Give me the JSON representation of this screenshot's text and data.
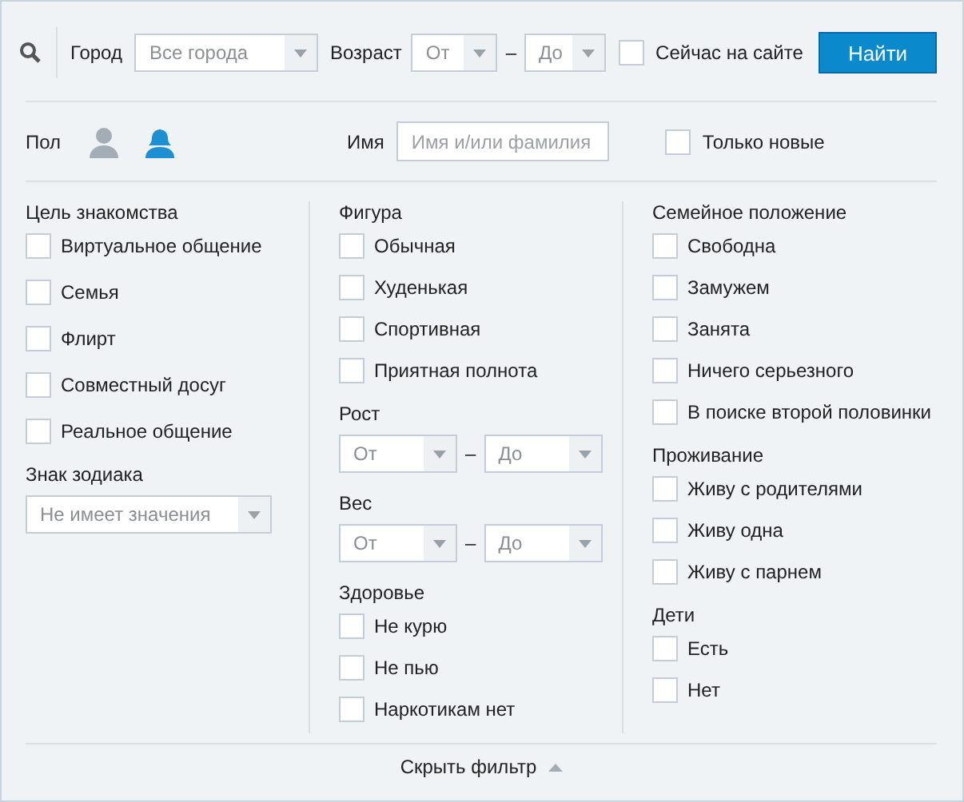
{
  "search": {
    "city": {
      "label": "Город",
      "value": "Все города"
    },
    "age": {
      "label": "Возраст",
      "from": "От",
      "dash": "–",
      "to": "До"
    },
    "online": {
      "label": "Сейчас на сайте",
      "checked": false
    },
    "button": "Найти"
  },
  "gender": {
    "label": "Пол",
    "options": [
      {
        "kind": "male",
        "selected": false
      },
      {
        "kind": "female",
        "selected": true
      }
    ]
  },
  "name": {
    "label": "Имя",
    "placeholder": "Имя и/или фамилия"
  },
  "only_new": {
    "label": "Только новые",
    "checked": false
  },
  "columns": [
    [
      {
        "title": "Цель знакомства",
        "kind": "checkboxes",
        "options": [
          {
            "label": "Виртуальное общение",
            "checked": false
          },
          {
            "label": "Семья",
            "checked": false
          },
          {
            "label": "Флирт",
            "checked": false
          },
          {
            "label": "Совместный досуг",
            "checked": false
          },
          {
            "label": "Реальное общение",
            "checked": false
          }
        ]
      },
      {
        "title": "Знак зодиака",
        "kind": "select",
        "value": "Не имеет значения"
      }
    ],
    [
      {
        "title": "Фигура",
        "kind": "checkboxes",
        "options": [
          {
            "label": "Обычная",
            "checked": false
          },
          {
            "label": "Худенькая",
            "checked": false
          },
          {
            "label": "Спортивная",
            "checked": false
          },
          {
            "label": "Приятная полнота",
            "checked": false
          }
        ]
      },
      {
        "title": "Рост",
        "kind": "range",
        "from": "От",
        "dash": "–",
        "to": "До"
      },
      {
        "title": "Вес",
        "kind": "range",
        "from": "От",
        "dash": "–",
        "to": "До"
      },
      {
        "title": "Здоровье",
        "kind": "checkboxes",
        "options": [
          {
            "label": "Не курю",
            "checked": false
          },
          {
            "label": "Не пью",
            "checked": false
          },
          {
            "label": "Наркотикам нет",
            "checked": false
          }
        ]
      }
    ],
    [
      {
        "title": "Семейное положение",
        "kind": "checkboxes",
        "options": [
          {
            "label": "Свободна",
            "checked": false
          },
          {
            "label": "Замужем",
            "checked": false
          },
          {
            "label": "Занята",
            "checked": false
          },
          {
            "label": "Ничего серьезного",
            "checked": false
          },
          {
            "label": "В поиске второй половинки",
            "checked": false
          }
        ]
      },
      {
        "title": "Проживание",
        "kind": "checkboxes",
        "options": [
          {
            "label": "Живу с родителями",
            "checked": false
          },
          {
            "label": "Живу одна",
            "checked": false
          },
          {
            "label": "Живу с парнем",
            "checked": false
          }
        ]
      },
      {
        "title": "Дети",
        "kind": "checkboxes",
        "options": [
          {
            "label": "Есть",
            "checked": false
          },
          {
            "label": "Нет",
            "checked": false
          }
        ]
      }
    ]
  ],
  "footer": {
    "label": "Скрыть фильтр"
  }
}
